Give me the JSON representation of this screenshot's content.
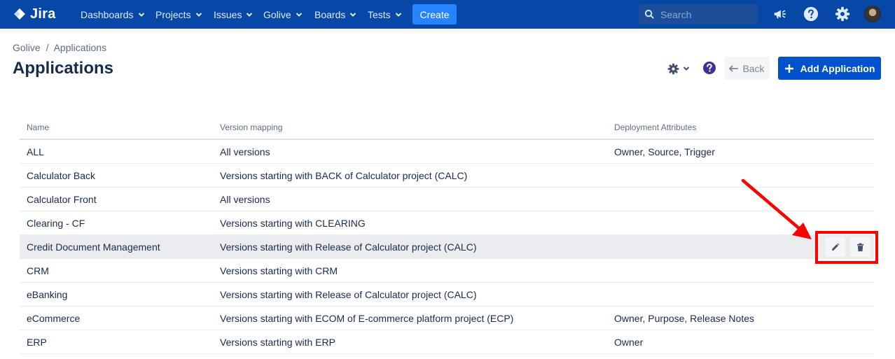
{
  "nav": {
    "logo_text": "Jira",
    "items": [
      {
        "label": "Dashboards"
      },
      {
        "label": "Projects"
      },
      {
        "label": "Issues"
      },
      {
        "label": "Golive"
      },
      {
        "label": "Boards"
      },
      {
        "label": "Tests"
      }
    ],
    "create_label": "Create",
    "search_placeholder": "Search",
    "icons": [
      "megaphone-icon",
      "help-icon",
      "settings-icon"
    ]
  },
  "breadcrumb": {
    "parent": "Golive",
    "separator": "/",
    "current": "Applications"
  },
  "page": {
    "title": "Applications",
    "back_label": "Back",
    "add_label": "Add Application"
  },
  "table": {
    "headers": [
      "Name",
      "Version mapping",
      "Deployment Attributes"
    ],
    "rows": [
      {
        "name": "ALL",
        "mapping": "All versions",
        "attributes": "Owner, Source, Trigger"
      },
      {
        "name": "Calculator Back",
        "mapping": "Versions starting with BACK of Calculator project (CALC)",
        "attributes": ""
      },
      {
        "name": "Calculator Front",
        "mapping": "All versions",
        "attributes": ""
      },
      {
        "name": "Clearing - CF",
        "mapping": "Versions starting with CLEARING",
        "attributes": ""
      },
      {
        "name": "Credit Document Management",
        "mapping": "Versions starting with Release of Calculator project (CALC)",
        "attributes": ""
      },
      {
        "name": "CRM",
        "mapping": "Versions starting with CRM",
        "attributes": ""
      },
      {
        "name": "eBanking",
        "mapping": "Versions starting with Release of Calculator project (CALC)",
        "attributes": ""
      },
      {
        "name": "eCommerce",
        "mapping": "Versions starting with ECOM of E-commerce platform project (ECP)",
        "attributes": "Owner, Purpose, Release Notes"
      },
      {
        "name": "ERP",
        "mapping": "Versions starting with ERP",
        "attributes": "Owner"
      }
    ]
  },
  "colors": {
    "nav_bg": "#0747a6",
    "primary": "#0052cc",
    "create_bg": "#2684ff",
    "annotation": "#ff0000"
  }
}
